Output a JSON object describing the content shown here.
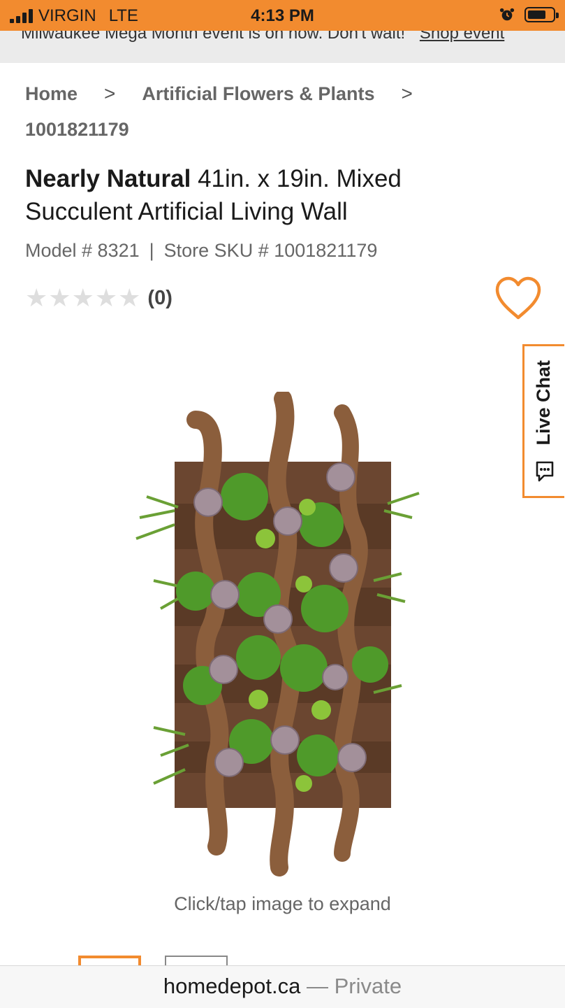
{
  "status_bar": {
    "carrier": "VIRGIN",
    "network": "LTE",
    "time": "4:13 PM"
  },
  "promo": {
    "text": "Milwaukee Mega Month event is on now. Don't wait!",
    "link": "Shop event"
  },
  "breadcrumb": {
    "home": "Home",
    "category": "Artificial Flowers & Plants",
    "current": "1001821179",
    "separator": ">"
  },
  "product": {
    "brand": "Nearly Natural",
    "title": "41in. x 19in. Mixed Succulent Artificial Living Wall",
    "model_label": "Model # 8321",
    "separator": "|",
    "sku_label": "Store SKU # 1001821179",
    "rating_value": 0,
    "rating_count": "(0)",
    "expand_hint": "Click/tap image to expand"
  },
  "live_chat": {
    "label": "Live Chat"
  },
  "url_bar": {
    "domain": "homedepot.ca",
    "private": "— Private"
  },
  "colors": {
    "brand_orange": "#f28b2f",
    "promo_bg": "#ebebeb",
    "star_empty": "#dedede"
  },
  "icons": {
    "favorite": "heart-outline-icon",
    "chat": "chat-bubble-icon",
    "alarm": "alarm-icon",
    "battery": "battery-icon",
    "signal": "signal-bars-icon"
  }
}
